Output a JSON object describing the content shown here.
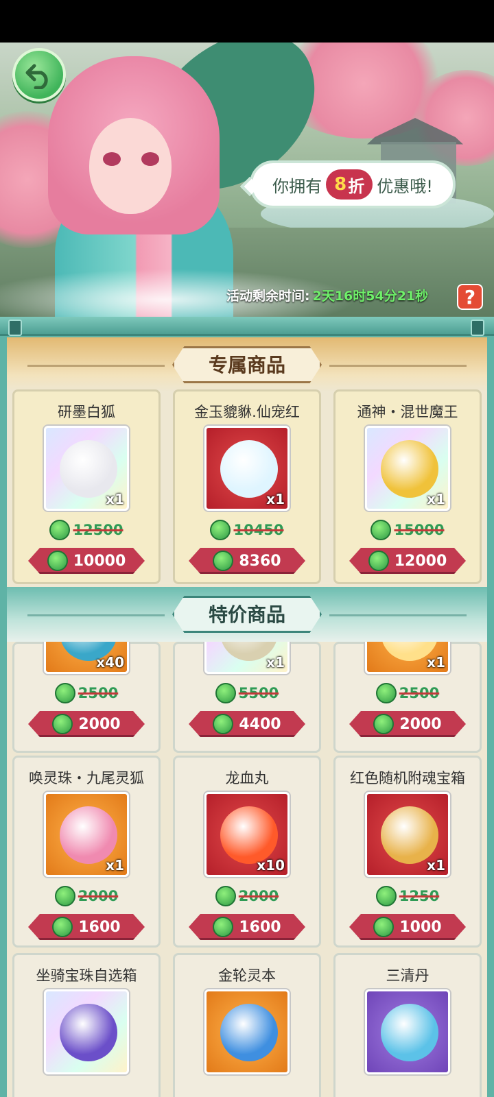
{
  "banner": {
    "bubble_prefix": "你拥有",
    "discount_number": "8",
    "discount_unit": "折",
    "bubble_suffix": "优惠哦!",
    "timer_label": "活动剩余时间:",
    "timer_value": "2天16时54分21秒",
    "help_label": "?"
  },
  "sections": {
    "exclusive_title": "专属商品",
    "special_title": "特价商品"
  },
  "exclusive_items": [
    {
      "name": "研墨白狐",
      "qty": "x1",
      "old_price": "12500",
      "price": "10000",
      "thumb_style": "rainbow",
      "art_color": "#e8e8ee"
    },
    {
      "name": "金玉貔貅.仙宠红",
      "qty": "x1",
      "old_price": "10450",
      "price": "8360",
      "thumb_style": "red",
      "art_color": "#dff5ff"
    },
    {
      "name": "通神・混世魔王",
      "qty": "x1",
      "old_price": "15000",
      "price": "12000",
      "thumb_style": "rainbow",
      "art_color": "#f0c23a"
    }
  ],
  "special_items": [
    {
      "name": "",
      "qty": "x40",
      "old_price": "2500",
      "price": "2000",
      "thumb_style": "orange",
      "art_color": "#3aa7c9"
    },
    {
      "name": "",
      "qty": "x1",
      "old_price": "5500",
      "price": "4400",
      "thumb_style": "rainbow",
      "art_color": "#d9d0b0"
    },
    {
      "name": "",
      "qty": "x1",
      "old_price": "2500",
      "price": "2000",
      "thumb_style": "orange",
      "art_color": "#ffe08a"
    },
    {
      "name": "唤灵珠・九尾灵狐",
      "qty": "x1",
      "old_price": "2000",
      "price": "1600",
      "thumb_style": "orange",
      "art_color": "#f08ab0"
    },
    {
      "name": "龙血丸",
      "qty": "x10",
      "old_price": "2000",
      "price": "1600",
      "thumb_style": "red",
      "art_color": "#ff5a2a"
    },
    {
      "name": "红色随机附魂宝箱",
      "qty": "x1",
      "old_price": "1250",
      "price": "1000",
      "thumb_style": "red",
      "art_color": "#e8b24a"
    },
    {
      "name": "坐骑宝珠自选箱",
      "qty": "",
      "old_price": "",
      "price": "",
      "thumb_style": "rainbow",
      "art_color": "#6b4fc9"
    },
    {
      "name": "金轮灵本",
      "qty": "",
      "old_price": "",
      "price": "",
      "thumb_style": "orange",
      "art_color": "#3f8fe0"
    },
    {
      "name": "三清丹",
      "qty": "",
      "old_price": "",
      "price": "",
      "thumb_style": "purple",
      "art_color": "#5cc2e8"
    }
  ]
}
